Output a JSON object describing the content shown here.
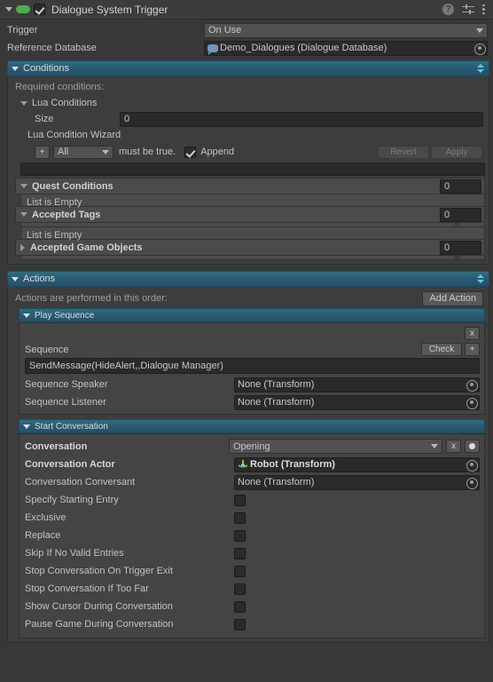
{
  "component": {
    "title": "Dialogue System Trigger",
    "enabled": true,
    "expanded": true,
    "icons": {
      "help": "?",
      "preset": "preset-icon",
      "menu": "kebab-menu-icon",
      "script": "script-icon"
    }
  },
  "properties": {
    "trigger": {
      "label": "Trigger",
      "value": "On Use"
    },
    "reference_database": {
      "label": "Reference Database",
      "value": "Demo_Dialogues (Dialogue Database)",
      "icon": "dialogue-database-icon"
    }
  },
  "conditions": {
    "header": "Conditions",
    "required_label": "Required conditions:",
    "lua_conditions": {
      "label": "Lua Conditions",
      "size_label": "Size",
      "size_value": "0"
    },
    "wizard": {
      "label": "Lua Condition Wizard",
      "add_button": "+",
      "mode": "All",
      "must_be_true": "must be true.",
      "append_label": "Append",
      "append_checked": true,
      "revert_button": "Revert",
      "apply_button": "Apply"
    },
    "quest_conditions": {
      "label": "Quest Conditions",
      "size": "0",
      "empty_text": "List is Empty",
      "expanded": true
    },
    "accepted_tags": {
      "label": "Accepted Tags",
      "size": "0",
      "empty_text": "List is Empty",
      "expanded": true
    },
    "accepted_game_objects": {
      "label": "Accepted Game Objects",
      "size": "0",
      "expanded": false
    }
  },
  "actions": {
    "header": "Actions",
    "order_text": "Actions are performed in this order:",
    "add_action_button": "Add Action",
    "play_sequence": {
      "header": "Play Sequence",
      "remove_button": "x",
      "sequence_label": "Sequence",
      "check_button": "Check",
      "plus_button": "+",
      "sequence_value": "SendMessage(HideAlert,,Dialogue Manager)",
      "speaker_label": "Sequence Speaker",
      "speaker_value": "None (Transform)",
      "listener_label": "Sequence Listener",
      "listener_value": "None (Transform)"
    },
    "start_conversation": {
      "header": "Start Conversation",
      "conversation_label": "Conversation",
      "conversation_value": "Opening",
      "clear_button": "x",
      "actor_label": "Conversation Actor",
      "actor_value": "Robot (Transform)",
      "conversant_label": "Conversation Conversant",
      "conversant_value": "None (Transform)",
      "toggles": [
        {
          "label": "Specify Starting Entry",
          "checked": false
        },
        {
          "label": "Exclusive",
          "checked": false
        },
        {
          "label": "Replace",
          "checked": false
        },
        {
          "label": "Skip If No Valid Entries",
          "checked": false
        },
        {
          "label": "Stop Conversation On Trigger Exit",
          "checked": false
        },
        {
          "label": "Stop Conversation If Too Far",
          "checked": false
        },
        {
          "label": "Show Cursor During Conversation",
          "checked": false
        },
        {
          "label": "Pause Game During Conversation",
          "checked": false
        }
      ]
    }
  },
  "colors": {
    "background": "#383838",
    "header_bg": "#3c3c3c",
    "section_teal": "#2a5d74",
    "accent_blue": "#5fc8ec",
    "script_green": "#4caf50"
  }
}
